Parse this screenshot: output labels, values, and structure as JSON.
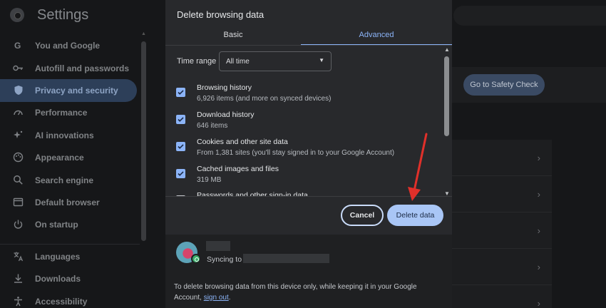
{
  "app": {
    "title": "Settings"
  },
  "sidebar": {
    "items": [
      {
        "label": "You and Google",
        "icon": "google-icon"
      },
      {
        "label": "Autofill and passwords",
        "icon": "key-icon"
      },
      {
        "label": "Privacy and security",
        "icon": "shield-icon",
        "active": true
      },
      {
        "label": "Performance",
        "icon": "speedometer-icon"
      },
      {
        "label": "AI innovations",
        "icon": "sparkle-icon"
      },
      {
        "label": "Appearance",
        "icon": "palette-icon"
      },
      {
        "label": "Search engine",
        "icon": "search-icon"
      },
      {
        "label": "Default browser",
        "icon": "browser-icon"
      },
      {
        "label": "On startup",
        "icon": "power-icon"
      },
      {
        "label": "Languages",
        "icon": "translate-icon"
      },
      {
        "label": "Downloads",
        "icon": "download-icon"
      },
      {
        "label": "Accessibility",
        "icon": "accessibility-icon"
      }
    ]
  },
  "main": {
    "safety_check_button": "Go to Safety Check"
  },
  "dialog": {
    "title": "Delete browsing data",
    "tabs": {
      "basic": "Basic",
      "advanced": "Advanced",
      "selected": "Advanced"
    },
    "time_range": {
      "label": "Time range",
      "value": "All time"
    },
    "options": [
      {
        "title": "Browsing history",
        "desc": "6,926 items (and more on synced devices)",
        "checked": true
      },
      {
        "title": "Download history",
        "desc": "646 items",
        "checked": true
      },
      {
        "title": "Cookies and other site data",
        "desc": "From 1,381 sites (you'll stay signed in to your Google Account)",
        "checked": true
      },
      {
        "title": "Cached images and files",
        "desc": "319 MB",
        "checked": true
      },
      {
        "title": "Passwords and other sign-in data",
        "desc": "",
        "checked": false
      }
    ],
    "buttons": {
      "cancel": "Cancel",
      "delete": "Delete data"
    },
    "footer": {
      "syncing_label": "Syncing to",
      "note_text": "To delete browsing data from this device only, while keeping it in your Google Account,",
      "sign_out_link": "sign out",
      "note_end": "."
    }
  },
  "colors": {
    "accent": "#8cb4f8",
    "dialog_bg": "#28292c",
    "page_bg": "#161719",
    "annotation_arrow": "#e0302a"
  }
}
